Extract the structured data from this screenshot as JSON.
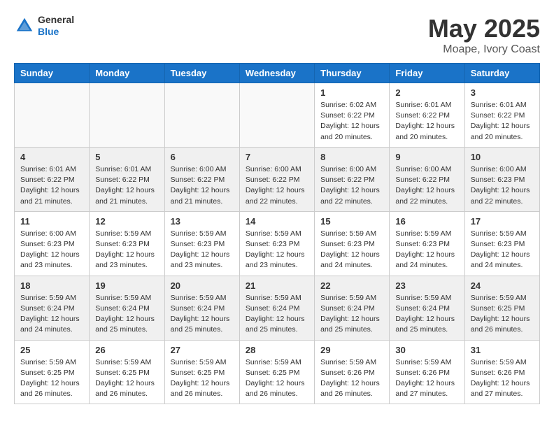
{
  "header": {
    "logo_general": "General",
    "logo_blue": "Blue",
    "month_title": "May 2025",
    "location": "Moape, Ivory Coast"
  },
  "weekdays": [
    "Sunday",
    "Monday",
    "Tuesday",
    "Wednesday",
    "Thursday",
    "Friday",
    "Saturday"
  ],
  "weeks": [
    [
      {
        "day": "",
        "info": ""
      },
      {
        "day": "",
        "info": ""
      },
      {
        "day": "",
        "info": ""
      },
      {
        "day": "",
        "info": ""
      },
      {
        "day": "1",
        "info": "Sunrise: 6:02 AM\nSunset: 6:22 PM\nDaylight: 12 hours\nand 20 minutes."
      },
      {
        "day": "2",
        "info": "Sunrise: 6:01 AM\nSunset: 6:22 PM\nDaylight: 12 hours\nand 20 minutes."
      },
      {
        "day": "3",
        "info": "Sunrise: 6:01 AM\nSunset: 6:22 PM\nDaylight: 12 hours\nand 20 minutes."
      }
    ],
    [
      {
        "day": "4",
        "info": "Sunrise: 6:01 AM\nSunset: 6:22 PM\nDaylight: 12 hours\nand 21 minutes."
      },
      {
        "day": "5",
        "info": "Sunrise: 6:01 AM\nSunset: 6:22 PM\nDaylight: 12 hours\nand 21 minutes."
      },
      {
        "day": "6",
        "info": "Sunrise: 6:00 AM\nSunset: 6:22 PM\nDaylight: 12 hours\nand 21 minutes."
      },
      {
        "day": "7",
        "info": "Sunrise: 6:00 AM\nSunset: 6:22 PM\nDaylight: 12 hours\nand 22 minutes."
      },
      {
        "day": "8",
        "info": "Sunrise: 6:00 AM\nSunset: 6:22 PM\nDaylight: 12 hours\nand 22 minutes."
      },
      {
        "day": "9",
        "info": "Sunrise: 6:00 AM\nSunset: 6:22 PM\nDaylight: 12 hours\nand 22 minutes."
      },
      {
        "day": "10",
        "info": "Sunrise: 6:00 AM\nSunset: 6:23 PM\nDaylight: 12 hours\nand 22 minutes."
      }
    ],
    [
      {
        "day": "11",
        "info": "Sunrise: 6:00 AM\nSunset: 6:23 PM\nDaylight: 12 hours\nand 23 minutes."
      },
      {
        "day": "12",
        "info": "Sunrise: 5:59 AM\nSunset: 6:23 PM\nDaylight: 12 hours\nand 23 minutes."
      },
      {
        "day": "13",
        "info": "Sunrise: 5:59 AM\nSunset: 6:23 PM\nDaylight: 12 hours\nand 23 minutes."
      },
      {
        "day": "14",
        "info": "Sunrise: 5:59 AM\nSunset: 6:23 PM\nDaylight: 12 hours\nand 23 minutes."
      },
      {
        "day": "15",
        "info": "Sunrise: 5:59 AM\nSunset: 6:23 PM\nDaylight: 12 hours\nand 24 minutes."
      },
      {
        "day": "16",
        "info": "Sunrise: 5:59 AM\nSunset: 6:23 PM\nDaylight: 12 hours\nand 24 minutes."
      },
      {
        "day": "17",
        "info": "Sunrise: 5:59 AM\nSunset: 6:23 PM\nDaylight: 12 hours\nand 24 minutes."
      }
    ],
    [
      {
        "day": "18",
        "info": "Sunrise: 5:59 AM\nSunset: 6:24 PM\nDaylight: 12 hours\nand 24 minutes."
      },
      {
        "day": "19",
        "info": "Sunrise: 5:59 AM\nSunset: 6:24 PM\nDaylight: 12 hours\nand 25 minutes."
      },
      {
        "day": "20",
        "info": "Sunrise: 5:59 AM\nSunset: 6:24 PM\nDaylight: 12 hours\nand 25 minutes."
      },
      {
        "day": "21",
        "info": "Sunrise: 5:59 AM\nSunset: 6:24 PM\nDaylight: 12 hours\nand 25 minutes."
      },
      {
        "day": "22",
        "info": "Sunrise: 5:59 AM\nSunset: 6:24 PM\nDaylight: 12 hours\nand 25 minutes."
      },
      {
        "day": "23",
        "info": "Sunrise: 5:59 AM\nSunset: 6:24 PM\nDaylight: 12 hours\nand 25 minutes."
      },
      {
        "day": "24",
        "info": "Sunrise: 5:59 AM\nSunset: 6:25 PM\nDaylight: 12 hours\nand 26 minutes."
      }
    ],
    [
      {
        "day": "25",
        "info": "Sunrise: 5:59 AM\nSunset: 6:25 PM\nDaylight: 12 hours\nand 26 minutes."
      },
      {
        "day": "26",
        "info": "Sunrise: 5:59 AM\nSunset: 6:25 PM\nDaylight: 12 hours\nand 26 minutes."
      },
      {
        "day": "27",
        "info": "Sunrise: 5:59 AM\nSunset: 6:25 PM\nDaylight: 12 hours\nand 26 minutes."
      },
      {
        "day": "28",
        "info": "Sunrise: 5:59 AM\nSunset: 6:25 PM\nDaylight: 12 hours\nand 26 minutes."
      },
      {
        "day": "29",
        "info": "Sunrise: 5:59 AM\nSunset: 6:26 PM\nDaylight: 12 hours\nand 26 minutes."
      },
      {
        "day": "30",
        "info": "Sunrise: 5:59 AM\nSunset: 6:26 PM\nDaylight: 12 hours\nand 27 minutes."
      },
      {
        "day": "31",
        "info": "Sunrise: 5:59 AM\nSunset: 6:26 PM\nDaylight: 12 hours\nand 27 minutes."
      }
    ]
  ]
}
